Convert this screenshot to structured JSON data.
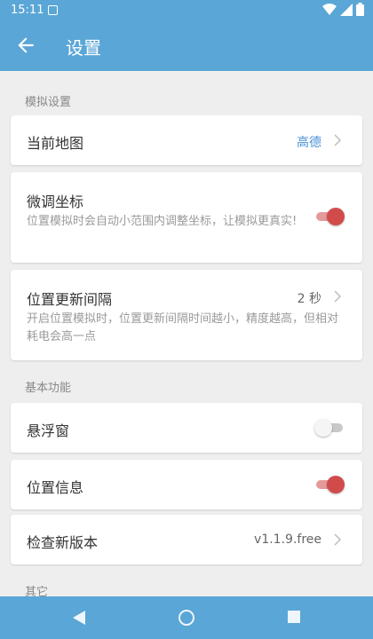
{
  "status_bar": {
    "time": "15:11"
  },
  "app_bar": {
    "title": "设置"
  },
  "sections": {
    "simulation": "模拟设置",
    "basic": "基本功能",
    "other": "其它"
  },
  "settings": {
    "current_map": {
      "label": "当前地图",
      "value": "高德"
    },
    "fine_tune": {
      "label": "微调坐标",
      "desc": "位置模拟时会自动小范围内调整坐标，让模拟更真实!",
      "enabled": true
    },
    "update_interval": {
      "label": "位置更新间隔",
      "value": "2 秒",
      "desc": "开启位置模拟时，位置更新间隔时间越小，精度越高，但相对耗电会高一点"
    },
    "floating_window": {
      "label": "悬浮窗",
      "enabled": false
    },
    "location_info": {
      "label": "位置信息",
      "enabled": true
    },
    "check_update": {
      "label": "检查新版本",
      "value": "v1.1.9.free"
    }
  },
  "colors": {
    "primary": "#5aa6d6",
    "accent_red": "#d24b4b",
    "link_blue": "#4a90d9"
  },
  "icons": [
    "back-arrow-icon",
    "image-icon",
    "wifi-icon",
    "signal-icon",
    "battery-icon",
    "chevron-right-icon",
    "nav-back-icon",
    "nav-home-icon",
    "nav-recents-icon"
  ]
}
